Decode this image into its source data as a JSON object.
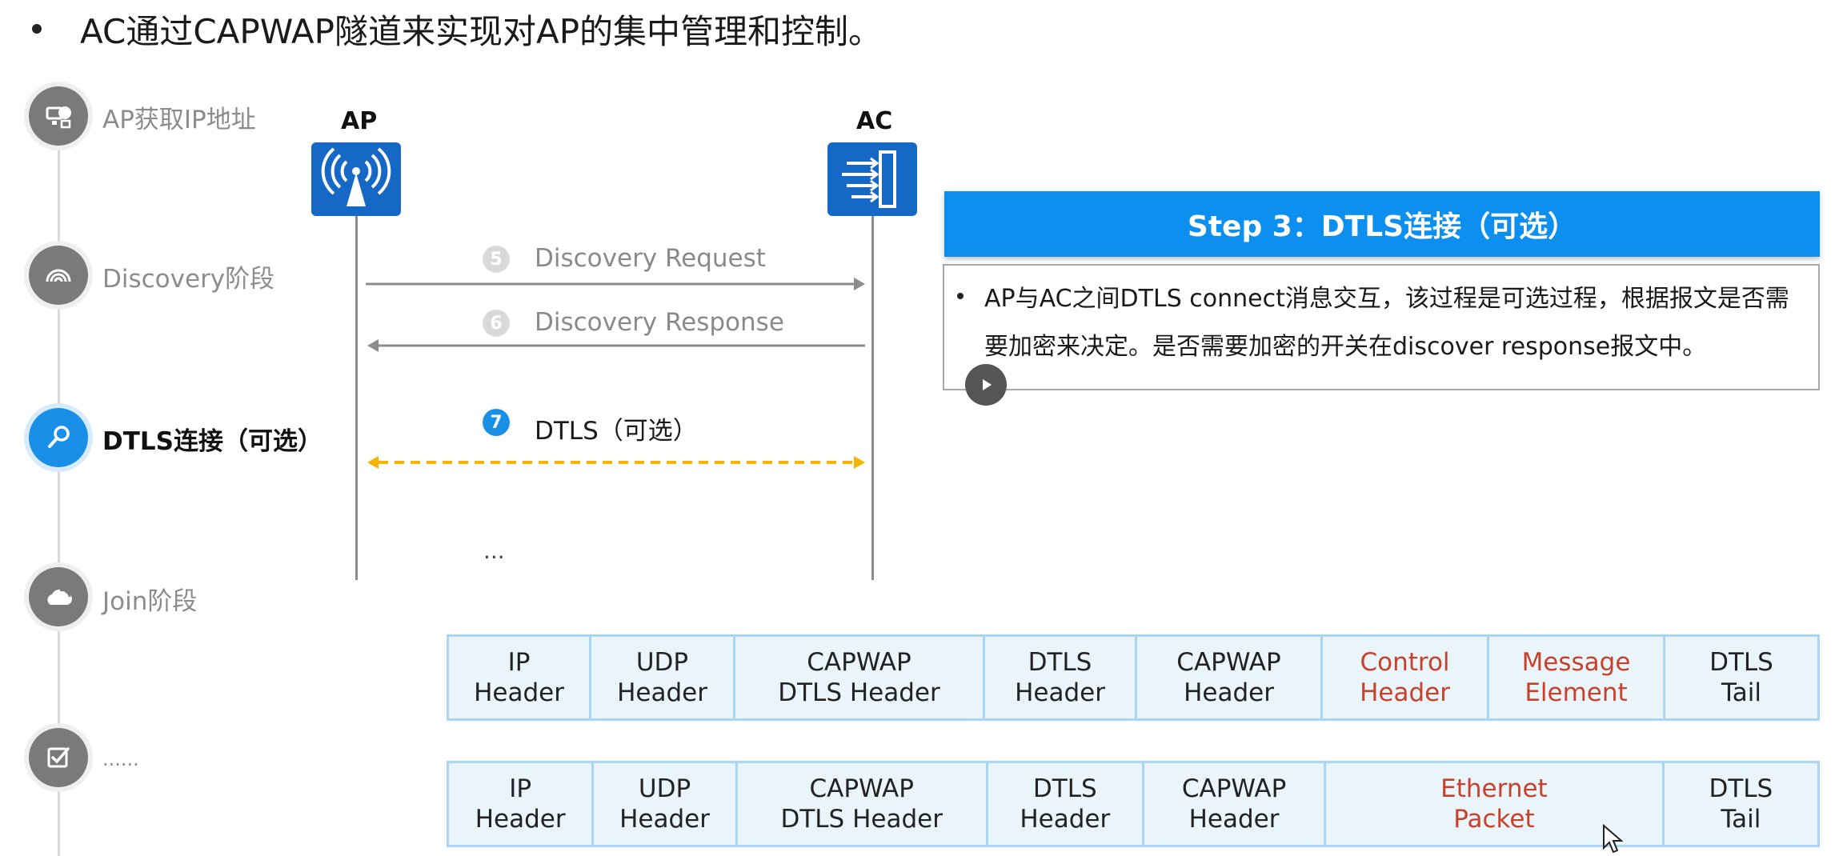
{
  "title": "AC通过CAPWAP隧道来实现对AP的集中管理和控制。",
  "timeline": {
    "steps": [
      {
        "label": "AP获取IP地址",
        "icon": "network-ip-icon",
        "active": false
      },
      {
        "label": "Discovery阶段",
        "icon": "wireless-signal-icon",
        "active": false
      },
      {
        "label": "DTLS连接（可选）",
        "icon": "key-icon",
        "active": true
      },
      {
        "label": "Join阶段",
        "icon": "cloud-join-icon",
        "active": false
      },
      {
        "label": "......",
        "icon": "checklist-icon",
        "active": false
      }
    ]
  },
  "diagram": {
    "ap_label": "AP",
    "ac_label": "AC",
    "messages": [
      {
        "num": "5",
        "label": "Discovery Request",
        "direction": "to-ac"
      },
      {
        "num": "6",
        "label": "Discovery Response",
        "direction": "to-ap"
      },
      {
        "num": "7",
        "label": "DTLS（可选）",
        "direction": "both"
      }
    ],
    "ellipsis": "..."
  },
  "panel": {
    "header": "Step 3：DTLS连接（可选）",
    "body": "AP与AC之间DTLS  connect消息交互，该过程是可选过程，根据报文是否需要加密来决定。是否需要加密的开关在discover response报文中。"
  },
  "packets": {
    "control": [
      "IP\nHeader",
      "UDP\nHeader",
      "CAPWAP\nDTLS Header",
      "DTLS\nHeader",
      "CAPWAP\nHeader",
      "Control\nHeader",
      "Message\nElement",
      "DTLS\nTail"
    ],
    "data": [
      "IP\nHeader",
      "UDP\nHeader",
      "CAPWAP\nDTLS Header",
      "DTLS\nHeader",
      "CAPWAP\nHeader",
      "Ethernet\nPacket",
      "DTLS\nTail"
    ]
  },
  "colors": {
    "accent": "#0c8fee",
    "active_step": "#1a8fe8",
    "highlight_text": "#c8412a",
    "dtls_arrow": "#f5b400",
    "ap_ac_icon": "#1668c7"
  }
}
